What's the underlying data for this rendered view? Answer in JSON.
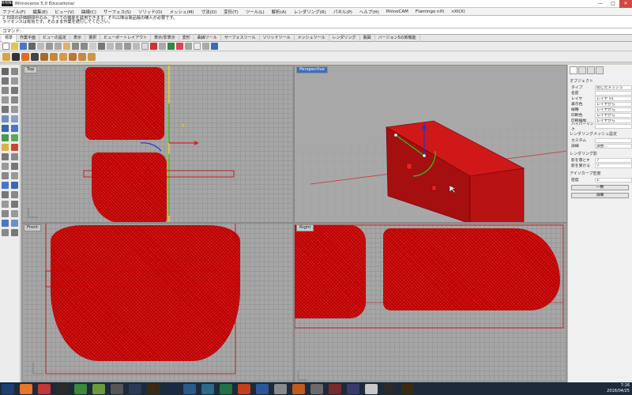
{
  "window": {
    "app_logo": "RHINO",
    "title": "Rhinoceros 5.0 Educational"
  },
  "window_controls": [
    "—",
    "□",
    "✕"
  ],
  "menu": [
    "ファイル(F)",
    "編集(E)",
    "ビュー(V)",
    "曲線(C)",
    "サーフェス(S)",
    "ソリッド(O)",
    "メッシュ(M)",
    "寸法(D)",
    "変形(T)",
    "ツール(L)",
    "解析(A)",
    "レンダリング(R)",
    "パネル(P)",
    "ヘルプ(H)",
    "RhinoCAM",
    "Flamingo nXt",
    "nXt(X)"
  ],
  "command_history": [
    "2 日間の評価期間中のみ、すべての機能を試用できます。それ以降は製品版の購入が必要です。",
    "ライセンスは有効です。そのまま作業を続行してください。"
  ],
  "command_prompt": "コマンド:",
  "tabs": [
    "標準",
    "作業平面",
    "ビューの設定",
    "表示",
    "選択",
    "ビューポートレイアウト",
    "表示/非表示",
    "変形",
    "曲線ツール",
    "サーフェスツール",
    "ソリッドツール",
    "メッシュツール",
    "レンダリング",
    "製図",
    "バージョン5の新機能"
  ],
  "viewports": {
    "top": "Top",
    "perspective": "Perspective",
    "front": "Front",
    "right": "Right"
  },
  "gumball_label": "z",
  "properties": {
    "tabs": [
      "オブジェクト",
      "レイヤ",
      "表示",
      "ヘルプ"
    ],
    "section_object": "オブジェクト",
    "rows": [
      {
        "label": "タイプ",
        "value": "閉じたメッシュ"
      },
      {
        "label": "名前",
        "value": ""
      },
      {
        "label": "レイヤ",
        "value": "レイヤ 01"
      },
      {
        "label": "表示色",
        "value": "レイヤから"
      },
      {
        "label": "線種",
        "value": "レイヤから"
      },
      {
        "label": "印刷色",
        "value": "レイヤから"
      },
      {
        "label": "印刷線幅",
        "value": "レイヤから"
      },
      {
        "label": "ハイパーリンク",
        "value": ""
      }
    ],
    "section_render": "レンダリングメッシュ設定",
    "render_rows": [
      {
        "label": "カスタム",
        "value": ""
      },
      {
        "label": "詳細",
        "value": "調整..."
      }
    ],
    "section_shadow": "レンダリング影",
    "shadow_rows": [
      {
        "label": "影を落とす",
        "value": "✓"
      },
      {
        "label": "影を受ける",
        "value": "✓"
      }
    ],
    "section_iso": "アイソカーブ密度",
    "iso_rows": [
      {
        "label": "密度",
        "value": "1"
      }
    ],
    "buttons": [
      "一致",
      "詳細"
    ]
  },
  "clock": {
    "time": "7:16",
    "date": "2016/04/25"
  },
  "colors": {
    "mesh": "#cc0000",
    "viewport_bg": "#a6a6a6",
    "accent": "#3d6fb6"
  }
}
